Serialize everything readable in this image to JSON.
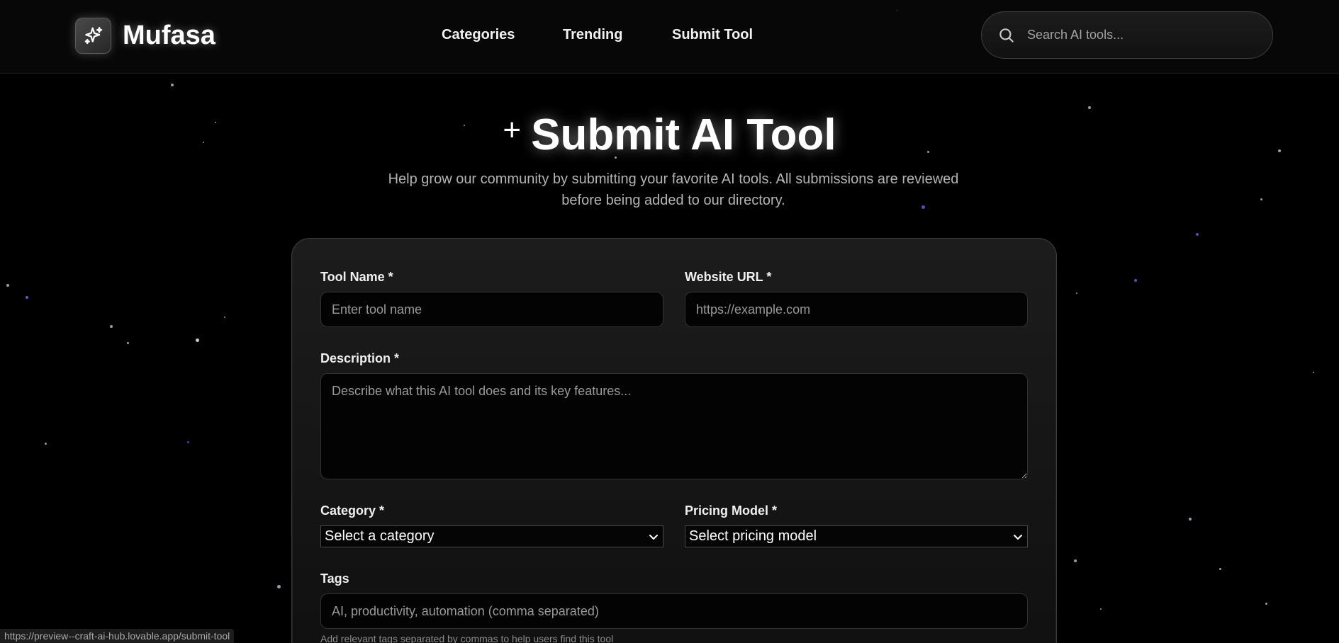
{
  "header": {
    "brand": "Mufasa",
    "nav": [
      {
        "label": "Categories"
      },
      {
        "label": "Trending"
      },
      {
        "label": "Submit Tool"
      }
    ],
    "search_placeholder": "Search AI tools..."
  },
  "hero": {
    "plus_glyph": "+",
    "title": "Submit AI Tool",
    "subtitle": "Help grow our community by submitting your favorite AI tools. All submissions are reviewed before being added to our directory."
  },
  "form": {
    "tool_name": {
      "label": "Tool Name *",
      "placeholder": "Enter tool name",
      "value": ""
    },
    "website_url": {
      "label": "Website URL *",
      "placeholder": "https://example.com",
      "value": ""
    },
    "description": {
      "label": "Description *",
      "placeholder": "Describe what this AI tool does and its key features...",
      "value": ""
    },
    "category": {
      "label": "Category *",
      "selected": "Select a category"
    },
    "pricing": {
      "label": "Pricing Model *",
      "selected": "Select pricing model"
    },
    "tags": {
      "label": "Tags",
      "placeholder": "AI, productivity, automation (comma separated)",
      "value": "",
      "helper": "Add relevant tags separated by commas to help users find this tool"
    }
  },
  "status_bar": {
    "url": "https://preview--craft-ai-hub.lovable.app/submit-tool"
  },
  "icons": {
    "logo": "sparkles-icon",
    "search": "search-icon",
    "plus": "plus-icon",
    "select": "chevron-down-icon"
  },
  "colors": {
    "background": "#000000",
    "card": "#161616",
    "input_bg": "#030303",
    "text_muted": "#b4b4b4"
  }
}
